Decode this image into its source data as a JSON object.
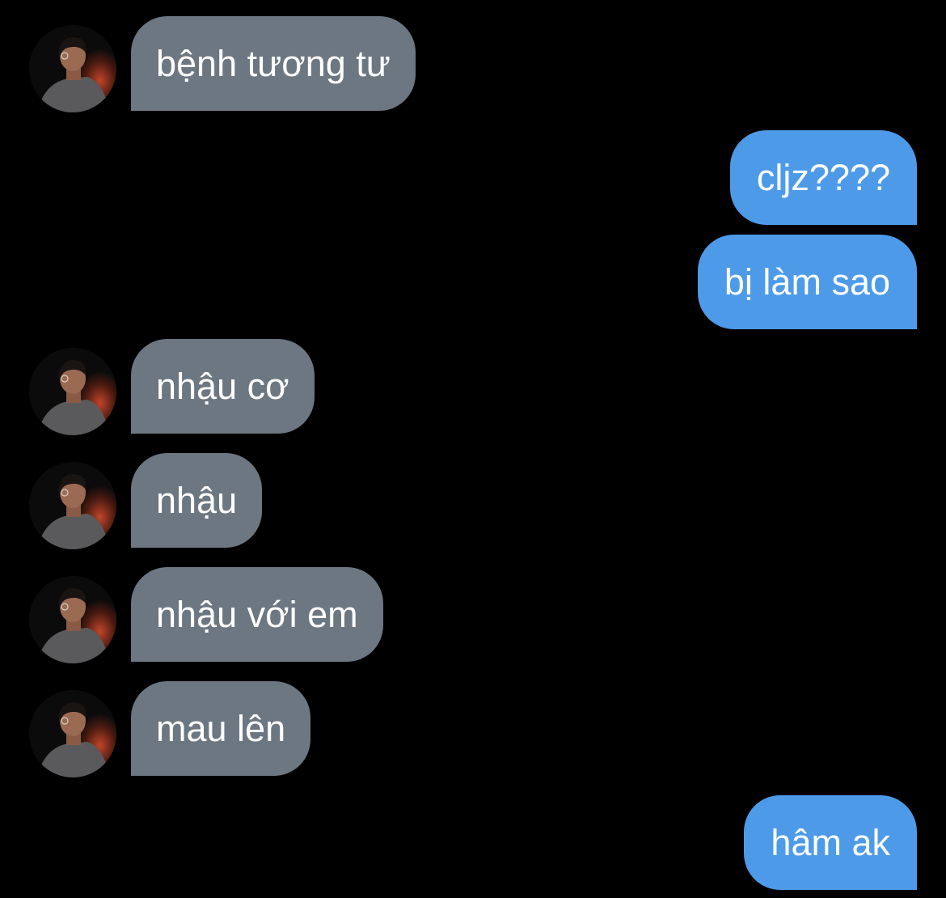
{
  "colors": {
    "background": "#000000",
    "incoming_bubble": "#6c7782",
    "outgoing_bubble": "#4d9be8",
    "text": "#ffffff"
  },
  "avatar_icon": "profile-photo-icon",
  "messages": [
    {
      "sender": "other",
      "text": "bệnh tương tư"
    },
    {
      "sender": "me",
      "text": "cljz????"
    },
    {
      "sender": "me",
      "text": "bị làm sao"
    },
    {
      "sender": "other",
      "text": "nhậu cơ"
    },
    {
      "sender": "other",
      "text": "nhậu"
    },
    {
      "sender": "other",
      "text": "nhậu với em"
    },
    {
      "sender": "other",
      "text": "mau lên"
    },
    {
      "sender": "me",
      "text": "hâm ak"
    }
  ]
}
